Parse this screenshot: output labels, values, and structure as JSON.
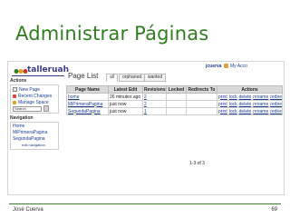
{
  "slide": {
    "title": "Administrar Páginas",
    "author": "José Cuerva",
    "page_number": "69"
  },
  "wiki": {
    "site_name": "talleruah",
    "user": "jcuerva",
    "account_link": "My Acco",
    "page_title": "Page List",
    "tabs": [
      {
        "label": "all",
        "active": true
      },
      {
        "label": "orphaned",
        "active": false
      },
      {
        "label": "wanted",
        "active": false
      }
    ],
    "sidebar": {
      "actions_heading": "Actions",
      "actions": [
        {
          "label": "New Page",
          "icon": "new-page-icon"
        },
        {
          "label": "Recent Changes",
          "icon": "recent-changes-icon"
        },
        {
          "label": "Manage Space",
          "icon": "manage-space-icon"
        }
      ],
      "search_value": "Search",
      "navigation_heading": "Navigation",
      "navigation": [
        "Home",
        "MiPrimeraPagina",
        "SegundaPagina"
      ],
      "edit_navigation": "edit navigation"
    },
    "table": {
      "columns": [
        "Page Name",
        "Latest Edit",
        "Revisions",
        "Locked",
        "Redirects To",
        "Actions"
      ],
      "rows": [
        {
          "name": "home",
          "latest_edit": "26 minutes ago",
          "revisions": "2",
          "locked": "",
          "redirects_to": ""
        },
        {
          "name": "MiPrimeraPagina",
          "latest_edit": "just now",
          "revisions": "2",
          "locked": "",
          "redirects_to": ""
        },
        {
          "name": "SegundaPagina",
          "latest_edit": "just now",
          "revisions": "1",
          "locked": "",
          "redirects_to": ""
        }
      ],
      "row_actions": [
        "print",
        "lock",
        "delete",
        "rename",
        "redirect"
      ],
      "pagination": "1-3 of 3"
    },
    "colors": {
      "link": "#1a3d8f",
      "header_bg": "#d9d9d9",
      "slide_title": "#2e7d1f"
    }
  }
}
